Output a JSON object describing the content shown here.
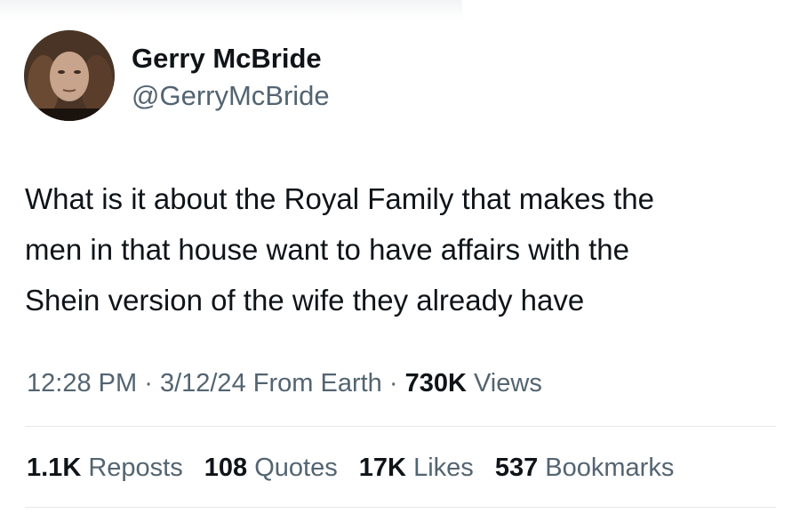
{
  "author": {
    "display_name": "Gerry McBride",
    "handle": "@GerryMcBride"
  },
  "tweet": {
    "lines": [
      "What is it about the Royal Family that makes the",
      "men in that house want to have affairs with the",
      "Shein version of the wife they already have"
    ]
  },
  "meta": {
    "time": "12:28 PM",
    "sep1": "·",
    "date": "3/12/24",
    "source": "From Earth",
    "sep2": "·",
    "views_count": "730K",
    "views_label": "Views"
  },
  "stats": {
    "reposts_count": "1.1K",
    "reposts_label": "Reposts",
    "quotes_count": "108",
    "quotes_label": "Quotes",
    "likes_count": "17K",
    "likes_label": "Likes",
    "bookmarks_count": "537",
    "bookmarks_label": "Bookmarks"
  },
  "icons": {
    "avatar": "profile-photo"
  }
}
